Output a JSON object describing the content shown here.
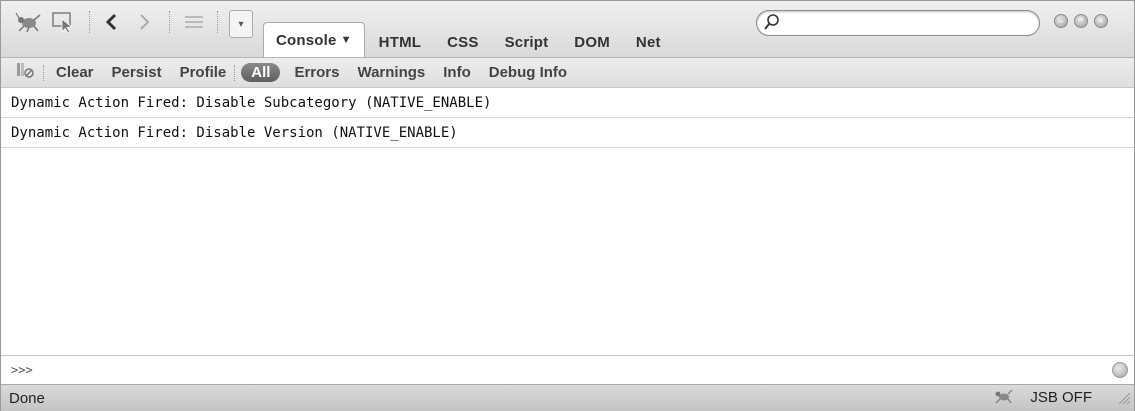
{
  "toolbar": {
    "icons": [
      "firebug-icon",
      "inspect-icon",
      "back-icon",
      "forward-icon",
      "list-icon",
      "dropdown-icon"
    ],
    "tabs": [
      {
        "label": "Console",
        "active": true
      },
      {
        "label": "HTML"
      },
      {
        "label": "CSS"
      },
      {
        "label": "Script"
      },
      {
        "label": "DOM"
      },
      {
        "label": "Net"
      }
    ],
    "dropdown_arrow": "▾",
    "search": {
      "value": "",
      "placeholder": ""
    },
    "window_buttons": [
      "minimize",
      "restore",
      "close"
    ]
  },
  "filterbar": {
    "clear": "Clear",
    "persist": "Persist",
    "profile": "Profile",
    "all": "All",
    "errors": "Errors",
    "warnings": "Warnings",
    "info": "Info",
    "debug_info": "Debug Info"
  },
  "log": {
    "rows": [
      "Dynamic Action Fired: Disable Subcategory (NATIVE_ENABLE)",
      "Dynamic Action Fired: Disable Version (NATIVE_ENABLE)"
    ]
  },
  "command": {
    "prompt": ">>>"
  },
  "status": {
    "text": "Done",
    "jsb": "JSB OFF"
  },
  "colors": {
    "toolbar_bg": "#e3e3e3",
    "pill_bg": "#6f6f6f",
    "border": "#9a9a9a"
  }
}
